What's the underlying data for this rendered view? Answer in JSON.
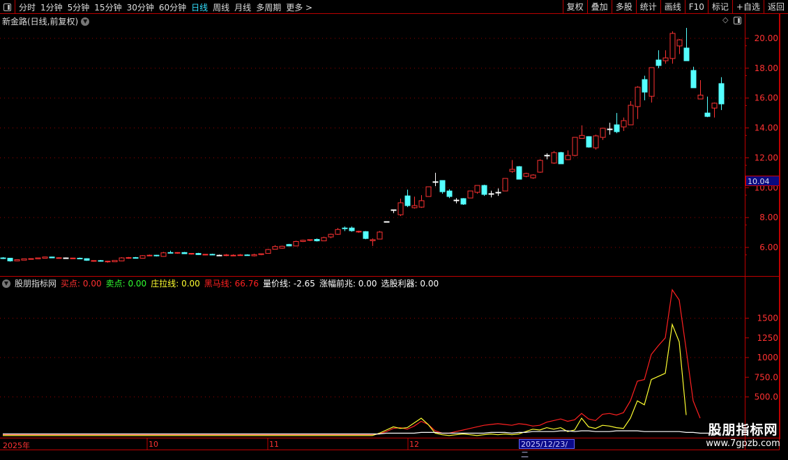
{
  "toolbar": {
    "periods": [
      "分时",
      "1分钟",
      "5分钟",
      "15分钟",
      "30分钟",
      "60分钟",
      "日线",
      "周线",
      "月线",
      "多周期",
      "更多 >"
    ],
    "active_period": "日线",
    "buttons": [
      "复权",
      "叠加",
      "多股",
      "统计",
      "画线",
      "F10",
      "标记",
      "+自选",
      "返回"
    ]
  },
  "chart_title": "新金路(日线,前复权)",
  "price_axis": {
    "ticks": [
      "20.00",
      "18.00",
      "16.00",
      "14.00",
      "12.00",
      "10.00",
      "8.00",
      "6.00"
    ],
    "values": [
      20,
      18,
      16,
      14,
      12,
      10,
      8,
      6
    ],
    "current_price": "10.04"
  },
  "indicator": {
    "name": "股朋指标网",
    "items": [
      {
        "label": "买点:",
        "value": "0.00",
        "color": "#ff3030"
      },
      {
        "label": "卖点:",
        "value": "0.00",
        "color": "#30ff30"
      },
      {
        "label": "庄拉线:",
        "value": "0.00",
        "color": "#ffff30"
      },
      {
        "label": "黑马线:",
        "value": "66.76",
        "color": "#ff2020"
      },
      {
        "label": "量价线:",
        "value": "-2.65",
        "color": "#ffffff"
      },
      {
        "label": "涨幅前兆:",
        "value": "0.00",
        "color": "#ffffff"
      },
      {
        "label": "选股利器:",
        "value": "0.00",
        "color": "#ffffff"
      }
    ],
    "axis_ticks": [
      "1500",
      "1250",
      "1000",
      "750.0",
      "500.0"
    ],
    "axis_values": [
      1500,
      1250,
      1000,
      750,
      500
    ]
  },
  "dates": {
    "labels": [
      "2025年",
      "10",
      "11",
      "12"
    ],
    "highlight": "2025/12/23/二"
  },
  "watermark": {
    "title": "股朋指标网",
    "url": "www.7gpzb.com"
  },
  "colors": {
    "up": "#ff3232",
    "down": "#54ffff",
    "grid": "#a00000",
    "active": "#33e0ff"
  },
  "chart_data": {
    "type": "candlestick",
    "ohlc": [
      [
        5.3,
        5.35,
        5.22,
        5.28
      ],
      [
        5.28,
        5.3,
        5.05,
        5.1
      ],
      [
        5.1,
        5.2,
        5.08,
        5.18
      ],
      [
        5.15,
        5.25,
        5.14,
        5.24
      ],
      [
        5.22,
        5.26,
        5.2,
        5.25
      ],
      [
        5.24,
        5.32,
        5.22,
        5.3
      ],
      [
        5.28,
        5.38,
        5.26,
        5.36
      ],
      [
        5.36,
        5.38,
        5.28,
        5.3
      ],
      [
        5.3,
        5.34,
        5.26,
        5.31
      ],
      [
        5.3,
        5.33,
        5.26,
        5.3
      ],
      [
        5.26,
        5.3,
        5.25,
        5.29
      ],
      [
        5.28,
        5.32,
        5.24,
        5.27
      ],
      [
        5.25,
        5.27,
        5.1,
        5.14
      ],
      [
        5.1,
        5.14,
        5.05,
        5.12
      ],
      [
        5.12,
        5.16,
        5.05,
        5.1
      ],
      [
        5.05,
        5.1,
        4.98,
        5.08
      ],
      [
        5.04,
        5.14,
        5.02,
        5.13
      ],
      [
        5.1,
        5.35,
        5.08,
        5.3
      ],
      [
        5.28,
        5.36,
        5.24,
        5.32
      ],
      [
        5.32,
        5.36,
        5.26,
        5.3
      ],
      [
        5.28,
        5.48,
        5.26,
        5.45
      ],
      [
        5.46,
        5.52,
        5.42,
        5.48
      ],
      [
        5.48,
        5.5,
        5.4,
        5.44
      ],
      [
        5.4,
        5.7,
        5.38,
        5.64
      ],
      [
        5.66,
        5.78,
        5.6,
        5.64
      ],
      [
        5.62,
        5.68,
        5.58,
        5.66
      ],
      [
        5.66,
        5.7,
        5.56,
        5.58
      ],
      [
        5.56,
        5.62,
        5.52,
        5.6
      ],
      [
        5.6,
        5.64,
        5.5,
        5.52
      ],
      [
        5.52,
        5.56,
        5.48,
        5.54
      ],
      [
        5.54,
        5.58,
        5.5,
        5.5
      ],
      [
        5.48,
        5.52,
        5.44,
        5.48
      ],
      [
        5.46,
        5.56,
        5.42,
        5.5
      ],
      [
        5.44,
        5.54,
        5.42,
        5.48
      ],
      [
        5.46,
        5.56,
        5.44,
        5.5
      ],
      [
        5.5,
        5.54,
        5.44,
        5.46
      ],
      [
        5.44,
        5.58,
        5.4,
        5.52
      ],
      [
        5.52,
        5.6,
        5.48,
        5.58
      ],
      [
        5.6,
        5.9,
        5.58,
        5.86
      ],
      [
        5.88,
        6.15,
        5.86,
        6.06
      ],
      [
        5.95,
        6.12,
        5.92,
        6.08
      ],
      [
        6.2,
        6.24,
        6.08,
        6.1
      ],
      [
        6.1,
        6.45,
        6.08,
        6.4
      ],
      [
        6.4,
        6.52,
        6.36,
        6.48
      ],
      [
        6.48,
        6.54,
        6.42,
        6.52
      ],
      [
        6.54,
        6.6,
        6.4,
        6.44
      ],
      [
        6.44,
        6.72,
        6.42,
        6.66
      ],
      [
        6.7,
        6.92,
        6.62,
        6.88
      ],
      [
        6.88,
        7.3,
        6.84,
        7.2
      ],
      [
        7.3,
        7.4,
        7.1,
        7.28
      ],
      [
        7.3,
        7.4,
        7.05,
        7.12
      ],
      [
        7.04,
        7.12,
        6.98,
        7.08
      ],
      [
        7.06,
        7.1,
        6.55,
        6.6
      ],
      [
        6.45,
        6.6,
        6.1,
        6.52
      ],
      [
        6.56,
        7.1,
        6.54,
        7.03
      ],
      [
        7.73,
        7.75,
        7.71,
        7.73
      ],
      [
        8.52,
        8.52,
        8.3,
        8.52
      ],
      [
        8.19,
        9.27,
        8.1,
        8.99
      ],
      [
        9.45,
        9.87,
        8.7,
        8.8
      ],
      [
        8.66,
        9.4,
        8.6,
        8.8
      ],
      [
        8.7,
        9.5,
        8.65,
        9.13
      ],
      [
        9.41,
        10.06,
        9.41,
        10.06
      ],
      [
        10.4,
        11.0,
        10.1,
        10.4
      ],
      [
        10.48,
        10.5,
        9.6,
        9.73
      ],
      [
        9.78,
        9.9,
        9.3,
        9.41
      ],
      [
        9.17,
        9.3,
        8.95,
        9.17
      ],
      [
        9.27,
        9.3,
        8.85,
        8.9
      ],
      [
        9.31,
        9.78,
        9.31,
        9.78
      ],
      [
        9.69,
        10.15,
        9.6,
        10.15
      ],
      [
        10.15,
        10.2,
        9.45,
        9.55
      ],
      [
        9.6,
        9.8,
        9.35,
        9.6
      ],
      [
        9.69,
        9.95,
        9.45,
        9.69
      ],
      [
        9.78,
        10.62,
        9.78,
        10.62
      ],
      [
        11.09,
        11.85,
        11.0,
        11.23
      ],
      [
        11.41,
        11.45,
        10.55,
        10.57
      ],
      [
        10.76,
        11.0,
        10.7,
        10.95
      ],
      [
        10.66,
        10.9,
        10.6,
        10.85
      ],
      [
        11.04,
        11.9,
        11.0,
        11.83
      ],
      [
        12.17,
        12.3,
        11.9,
        12.17
      ],
      [
        11.65,
        12.45,
        11.6,
        12.35
      ],
      [
        12.35,
        12.4,
        11.6,
        11.6
      ],
      [
        11.88,
        12.5,
        11.85,
        12.16
      ],
      [
        12.16,
        13.37,
        12.1,
        13.37
      ],
      [
        13.3,
        14.17,
        13.28,
        13.5
      ],
      [
        13.42,
        13.45,
        12.68,
        12.72
      ],
      [
        12.67,
        13.55,
        12.55,
        13.47
      ],
      [
        13.37,
        14.0,
        13.2,
        13.98
      ],
      [
        13.93,
        14.35,
        13.55,
        13.93
      ],
      [
        14.21,
        15.0,
        13.65,
        13.75
      ],
      [
        14.07,
        14.7,
        13.8,
        14.49
      ],
      [
        14.21,
        15.8,
        14.21,
        15.52
      ],
      [
        15.43,
        16.8,
        14.6,
        16.73
      ],
      [
        17.24,
        17.5,
        15.85,
        16.4
      ],
      [
        16.12,
        18.04,
        15.7,
        18.04
      ],
      [
        18.55,
        19.2,
        18.0,
        18.18
      ],
      [
        18.5,
        19.2,
        18.3,
        18.69
      ],
      [
        18.65,
        20.47,
        18.3,
        20.33
      ],
      [
        19.49,
        19.95,
        18.95,
        19.9
      ],
      [
        19.35,
        20.7,
        18.5,
        18.5
      ],
      [
        17.85,
        18.1,
        16.69,
        16.69
      ],
      [
        15.94,
        17.2,
        15.94,
        16.2
      ],
      [
        15.0,
        16.1,
        14.72,
        14.77
      ],
      [
        15.33,
        15.7,
        14.7,
        15.66
      ],
      [
        16.97,
        17.4,
        15.2,
        15.61
      ]
    ],
    "indicator_series": [
      {
        "name": "黑马线",
        "color": "#ff2020",
        "values": [
          20,
          20,
          20,
          20,
          20,
          20,
          20,
          20,
          20,
          20,
          20,
          20,
          20,
          20,
          20,
          20,
          20,
          20,
          20,
          20,
          20,
          20,
          20,
          20,
          20,
          20,
          20,
          20,
          20,
          20,
          20,
          20,
          20,
          20,
          20,
          20,
          20,
          20,
          20,
          20,
          20,
          20,
          20,
          20,
          20,
          20,
          20,
          20,
          20,
          20,
          20,
          20,
          20,
          20,
          30,
          60,
          100,
          110,
          90,
          130,
          190,
          150,
          70,
          40,
          40,
          60,
          80,
          100,
          120,
          140,
          150,
          160,
          150,
          140,
          160,
          150,
          130,
          140,
          180,
          200,
          220,
          190,
          210,
          290,
          220,
          200,
          280,
          290,
          270,
          300,
          450,
          700,
          720,
          1040,
          1150,
          1250,
          1860,
          1730,
          1100,
          450,
          230,
          null,
          null,
          null
        ]
      },
      {
        "name": "庄拉线",
        "color": "#ffff30",
        "values": [
          10,
          10,
          10,
          10,
          10,
          10,
          10,
          10,
          10,
          10,
          10,
          10,
          10,
          10,
          10,
          10,
          10,
          10,
          10,
          10,
          10,
          10,
          10,
          10,
          10,
          10,
          10,
          10,
          10,
          10,
          10,
          10,
          10,
          10,
          10,
          10,
          10,
          10,
          10,
          10,
          10,
          10,
          10,
          10,
          10,
          10,
          10,
          10,
          10,
          10,
          10,
          10,
          10,
          10,
          40,
          80,
          120,
          100,
          110,
          170,
          230,
          150,
          40,
          20,
          10,
          20,
          30,
          20,
          10,
          20,
          30,
          20,
          30,
          20,
          30,
          60,
          90,
          80,
          110,
          90,
          110,
          60,
          80,
          230,
          120,
          100,
          140,
          130,
          110,
          100,
          230,
          450,
          400,
          720,
          760,
          800,
          1420,
          1200,
          270,
          null,
          null,
          null,
          null,
          null
        ]
      },
      {
        "name": "量价线",
        "color": "#ffffff",
        "values": [
          30,
          30,
          30,
          30,
          30,
          30,
          30,
          30,
          30,
          30,
          30,
          30,
          30,
          30,
          30,
          30,
          30,
          30,
          30,
          30,
          30,
          30,
          30,
          30,
          30,
          30,
          30,
          30,
          30,
          30,
          30,
          30,
          30,
          30,
          30,
          30,
          30,
          30,
          30,
          30,
          30,
          30,
          30,
          30,
          30,
          30,
          30,
          30,
          30,
          30,
          30,
          30,
          30,
          30,
          30,
          40,
          40,
          40,
          40,
          40,
          50,
          50,
          50,
          40,
          40,
          40,
          40,
          40,
          40,
          40,
          50,
          50,
          50,
          40,
          50,
          50,
          60,
          60,
          60,
          60,
          70,
          70,
          60,
          70,
          70,
          60,
          60,
          60,
          70,
          70,
          70,
          70,
          60,
          60,
          60,
          60,
          60,
          60,
          50,
          50,
          40,
          40,
          40,
          40
        ]
      }
    ]
  }
}
